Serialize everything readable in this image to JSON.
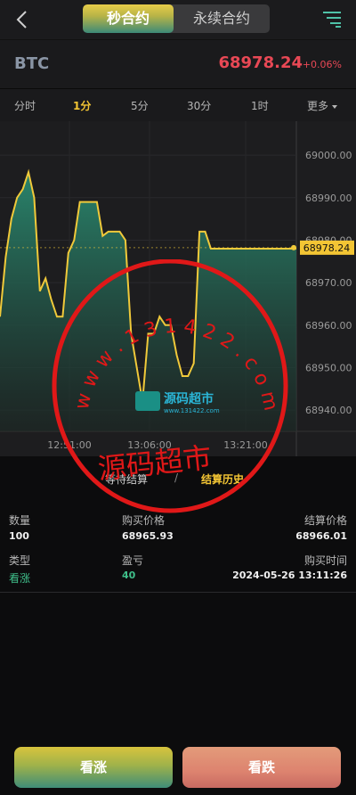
{
  "header": {
    "tabs": [
      "秒合约",
      "永续合约"
    ],
    "active_tab": 0
  },
  "ticker": {
    "symbol": "BTC",
    "price": "68978.24",
    "change": "+0.06%",
    "change_color": "#e84855"
  },
  "timeframes": {
    "items": [
      "分时",
      "1分",
      "5分",
      "30分",
      "1时",
      "更多"
    ],
    "active": "1分"
  },
  "chart_data": {
    "type": "area",
    "ylim": [
      68935,
      69008
    ],
    "yticks": [
      "69000.00",
      "68990.00",
      "68980.00",
      "68970.00",
      "68960.00",
      "68950.00",
      "68940.00"
    ],
    "xticks": [
      "12:51:00",
      "13:06:00",
      "13:21:00"
    ],
    "last_price": "68978.24",
    "line_color": "#f0c93a",
    "fill_color_top": "#2a8a70",
    "values": [
      68962,
      68976,
      68985,
      68990,
      68992,
      68996,
      68990,
      68968,
      68971,
      68966,
      68962,
      68962,
      68977,
      68980,
      68989,
      68989,
      68989,
      68989,
      68981,
      68982,
      68982,
      68982,
      68980,
      68958,
      68950,
      68942,
      68958,
      68958,
      68962,
      68960,
      68960,
      68953,
      68948,
      68948,
      68951,
      68982,
      68982,
      68978,
      68978,
      68978,
      68978,
      68978,
      68978,
      68978,
      68978,
      68978,
      68978,
      68978,
      68978,
      68978,
      68978,
      68978,
      68978
    ]
  },
  "result_tabs": {
    "pending": "等待结算",
    "separator": "/",
    "history": "结算历史"
  },
  "record": {
    "quantity_label": "数量",
    "quantity": "100",
    "buy_price_label": "购买价格",
    "buy_price": "68965.93",
    "settle_price_label": "结算价格",
    "settle_price": "68966.01",
    "type_label": "类型",
    "type": "看涨",
    "pnl_label": "盈亏",
    "pnl": "40",
    "buy_time_label": "购买时间",
    "buy_time": "2024-05-26 13:11:26"
  },
  "actions": {
    "up": "看涨",
    "down": "看跌"
  },
  "watermark": {
    "url_text": "w w w . 1 3 1 4 2 2 . c o m",
    "brand": "源码超市",
    "logo_text": "源码超市",
    "logo_sub": "www.131422.com",
    "color": "#e01818"
  }
}
